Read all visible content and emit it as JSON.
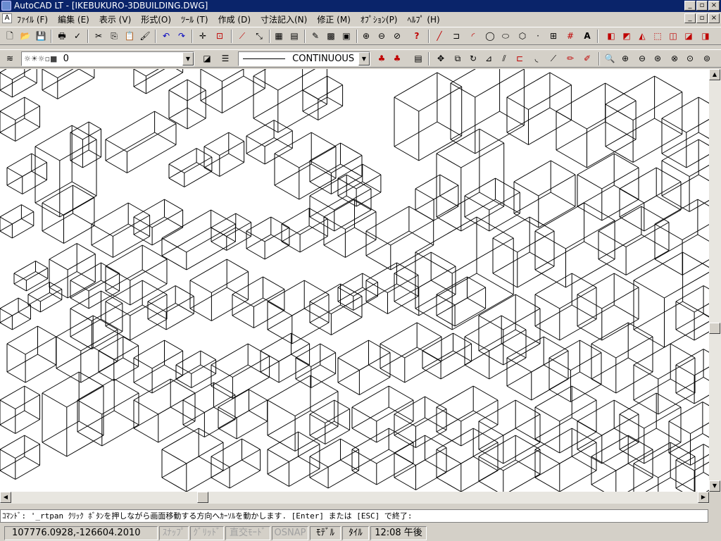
{
  "window": {
    "title": "AutoCAD LT - [IKEBUKURO-3DBUILDING.DWG]",
    "buttons": [
      "_",
      "▫",
      "×"
    ]
  },
  "menu": {
    "items": [
      "ﾌｧｲﾙ (F)",
      "編集 (E)",
      "表示 (V)",
      "形式(O)",
      "ﾂｰﾙ (T)",
      "作成 (D)",
      "寸法記入(N)",
      "修正 (M)",
      "ｵﾌﾟｼｮﾝ(P)",
      "ﾍﾙﾌﾟ (H)"
    ]
  },
  "layer": {
    "current": "0"
  },
  "linetype": {
    "current": "CONTINUOUS"
  },
  "command": {
    "prompt": "ｺﾏﾝﾄﾞ: '_rtpan ｸﾘｯｸ ﾎﾞﾀﾝを押しながら画面移動する方向へｶｰｿﾙを動かします. [Enter] または [ESC] で終了:"
  },
  "status": {
    "coords": "107776.0928,-126604.2010",
    "snap": "ｽﾅｯﾌﾟ",
    "grid": "ｸﾞﾘｯﾄﾞ",
    "ortho": "直交ﾓｰﾄﾞ",
    "osnap": "OSNAP",
    "model": "ﾓﾃﾞﾙ",
    "tile": "ﾀｲﾙ",
    "time": "12:08 午後"
  },
  "icons": {
    "tb1": [
      "new-icon",
      "open-icon",
      "save-icon",
      "print-icon",
      "spell-icon",
      "cut-icon",
      "copy-icon",
      "paste-icon",
      "match-prop-icon",
      "undo-icon",
      "redo-icon",
      "snap-from-icon",
      "zoom-window-icon",
      "distance-icon",
      "aerial-icon",
      "block-icon",
      "redraw-icon",
      "help-icon",
      "line-icon",
      "polyline-icon",
      "arc-icon",
      "circle-icon",
      "ellipse-icon",
      "polygon-icon",
      "point-icon",
      "insert-icon",
      "hatch-icon",
      "text-icon",
      "box-icon",
      "wedge-icon",
      "cone-icon",
      "cylinder-icon",
      "sphere-icon",
      "torus-icon"
    ],
    "tb2": [
      "zoom-realtime-icon",
      "zoom-in-icon",
      "zoom-out-icon",
      "zoom-all-icon",
      "zoom-extents-icon",
      "zoom-previous-icon"
    ]
  }
}
